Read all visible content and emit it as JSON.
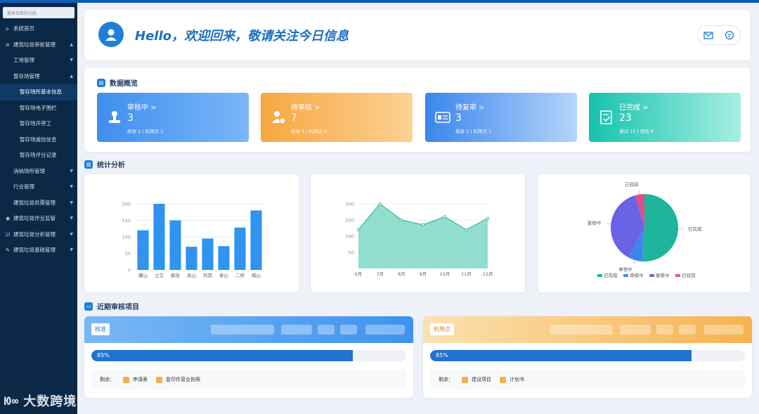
{
  "sidebar": {
    "search_placeholder": "搜索页面和功能",
    "items": [
      {
        "label": "系统首页",
        "icon": "home-icon"
      },
      {
        "label": "建筑垃圾审批管理",
        "icon": "list-icon"
      },
      {
        "label": "工地管理"
      },
      {
        "label": "暂存场管理"
      },
      {
        "label": "暂存场所基本信息"
      },
      {
        "label": "暂存场电子围栏"
      },
      {
        "label": "暂存场开停工"
      },
      {
        "label": "暂存场诚信信息"
      },
      {
        "label": "暂存场评分记录"
      },
      {
        "label": "消纳场所管理"
      },
      {
        "label": "行业管理"
      },
      {
        "label": "建筑垃圾供需管理"
      },
      {
        "label": "建筑垃圾作业监管",
        "icon": "eye-icon"
      },
      {
        "label": "建筑垃圾分析管理",
        "icon": "edit-icon"
      },
      {
        "label": "建筑垃圾基础管理",
        "icon": "pen-icon"
      }
    ]
  },
  "welcome": {
    "text": "Hello，欢迎回来，敬请关注今日信息"
  },
  "overview": {
    "title": "数据概览",
    "cards": [
      {
        "label": "审核中 >",
        "value": "3",
        "sub": "核准 2 | 利用点 1",
        "color": "#3f8ff0"
      },
      {
        "label": "待审核 >",
        "value": "7",
        "sub": "核准 4 | 利用点 3",
        "color": "#f7a740"
      },
      {
        "label": "待复审 >",
        "value": "3",
        "sub": "核准 2 | 利用点 1",
        "color": "#3b86ec"
      },
      {
        "label": "已完成 >",
        "value": "23",
        "sub": "通过 15 | 驳回 8",
        "color": "#16c2ae"
      }
    ]
  },
  "stats": {
    "title": "统计分析"
  },
  "chart_data": [
    {
      "type": "bar",
      "categories": [
        "耀山",
        "立交",
        "解放",
        "高山",
        "何其",
        "泰山",
        "二桥",
        "峨山"
      ],
      "values": [
        120,
        200,
        150,
        70,
        95,
        72,
        128,
        180
      ],
      "ylim": [
        0,
        200
      ],
      "yticks": [
        0,
        50,
        100,
        150,
        200
      ],
      "color": "#2f93f0",
      "grid": true
    },
    {
      "type": "area",
      "categories": [
        "6月",
        "7月",
        "8月",
        "9月",
        "10月",
        "11月",
        "12月"
      ],
      "values": [
        120,
        200,
        150,
        135,
        160,
        120,
        155
      ],
      "ylim": [
        0,
        200
      ],
      "yticks": [
        50,
        100,
        150,
        200
      ],
      "color": "#7fd8c6",
      "grid": true
    },
    {
      "type": "pie",
      "slices": [
        {
          "name": "已完成",
          "value": 23,
          "color": "#1fb59d"
        },
        {
          "name": "审核中",
          "value": 3,
          "color": "#3d85ee"
        },
        {
          "name": "复核中",
          "value": 17,
          "color": "#6a63e6"
        },
        {
          "name": "已驳回",
          "value": 2,
          "color": "#e24e8c"
        }
      ],
      "legend": [
        "已完成",
        "审核中",
        "复核中",
        "已驳回"
      ],
      "legend_position": "bottom"
    }
  ],
  "recent": {
    "title": "近期审核项目",
    "projects": [
      {
        "tag": "核准",
        "progress_label": "85%",
        "progress": 0.83,
        "remain_label": "剩余：",
        "items": [
          "申请表",
          "复印件营业执照"
        ]
      },
      {
        "tag": "利用点",
        "progress_label": "85%",
        "progress": 0.83,
        "remain_label": "剩余：",
        "items": [
          "建设项目",
          "计划书"
        ]
      }
    ]
  },
  "watermark": {
    "text": "大数跨境",
    "logo": "Ю∞"
  }
}
